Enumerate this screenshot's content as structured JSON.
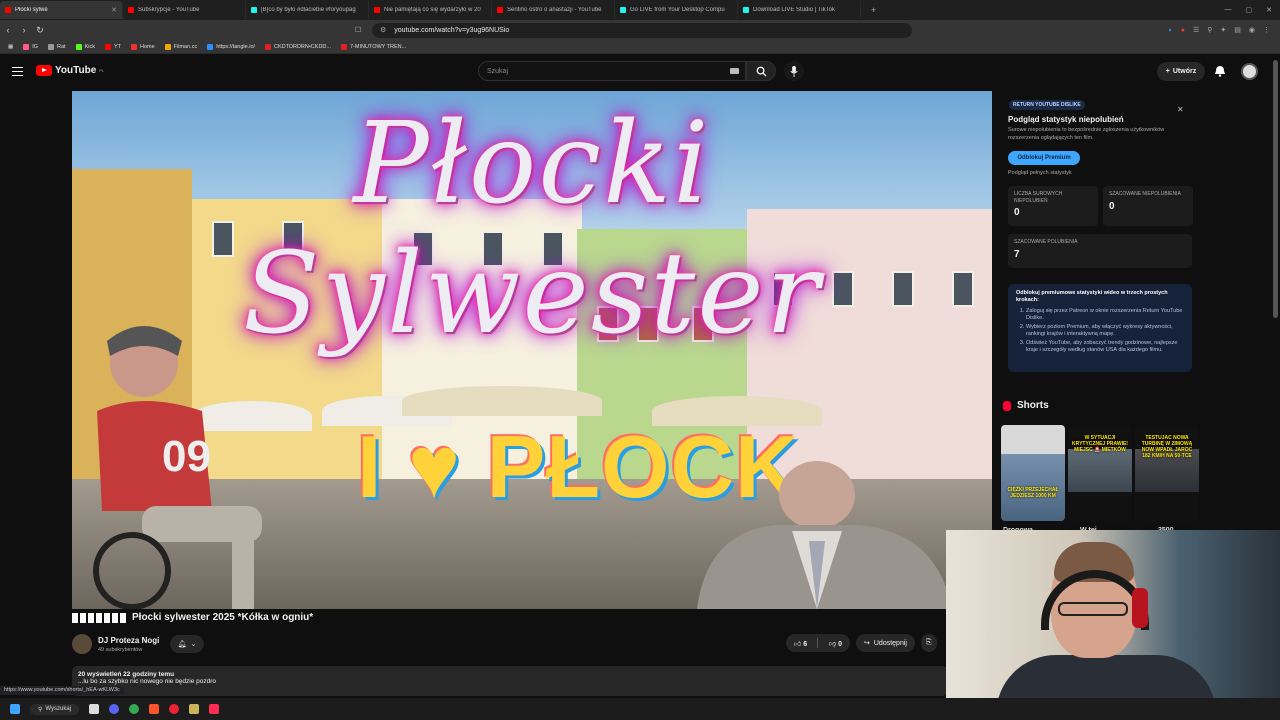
{
  "browser": {
    "tabs": [
      {
        "label": "Płocki sylwe",
        "color": "#ff0000",
        "active": true
      },
      {
        "label": "Subskrypcje - YouTube",
        "color": "#ff0000"
      },
      {
        "label": "[B]co by było #dlaciebie #foryoupag",
        "color": "#25f4ee"
      },
      {
        "label": "Nie pamiętają co się wydarzyło w 20",
        "color": "#ff0000"
      },
      {
        "label": "Sentino ostro o anastazji - YouTube",
        "color": "#ff0000"
      },
      {
        "label": "Go LIVE from Your Desktop Compu",
        "color": "#25f4ee"
      },
      {
        "label": "Download LIVE Studio | TikTok",
        "color": "#25f4ee"
      }
    ],
    "url": "youtube.com/watch?v=y3ug96NUSio",
    "bookmarks": [
      "IG",
      "Rat",
      "Kick",
      "YT",
      "Home",
      "Filman.cc",
      "https://tangle.io/",
      "CKDTDRDRN•CKDD...",
      "7-MINUTOWY TREN..."
    ]
  },
  "youtube": {
    "logo": "YouTube",
    "logo_region": "PL",
    "search_placeholder": "Szukaj",
    "create_label": "Utwórz"
  },
  "video": {
    "overlay_title": "Płocki Sylwester",
    "sign_text": "I ♥ PŁOCK",
    "title": "Płocki sylwester 2025 *Kółka w ogniu*",
    "channel": "DJ Proteza Nogi",
    "subscribers": "49 subskrybentów",
    "likes": "6",
    "dislikes": "0",
    "share_label": "Udostępnij",
    "views_time": "20 wyświetleń  22 godziny temu",
    "description": "...lu bo za szybko nic nowego nie będzie pozdro",
    "status_url": "https://www.youtube.com/shorts/_hEA-wKLW3c"
  },
  "rtd_panel": {
    "tag": "RETURN YOUTUBE DISLIKE",
    "title": "Podgląd statystyk niepolubień",
    "description": "Surowe niepolubienia to bezpośrednie zgłoszenia użytkowników rozszerzenia oglądających ten film.",
    "button": "Odblokuj Premium",
    "link": "Podgląd pełnych statystyk",
    "stats": [
      {
        "label": "LICZBA SUROWYCH NIEPOLUBIEŃ",
        "value": "0"
      },
      {
        "label": "SZACOWANE NIEPOLUBIENIA",
        "value": "0"
      },
      {
        "label": "SZACOWANE POLUBIENIA",
        "value": "7"
      }
    ],
    "premium_title": "Odblokuj premiumowe statystyki wideo w trzech prostych krokach:",
    "steps": [
      "Zaloguj się przez Patreon w oknie rozszerzenia Return YouTube Dislike.",
      "Wybierz poziom Premium, aby włączyć wykresy aktywności, rankingi krajów i interaktywną mapę.",
      "Odśwież YouTube, aby zobaczyć trendy godzinowe, najlepsze kraje i szczegóły według stanów USA dla każdego filmu."
    ]
  },
  "shorts": {
    "heading": "Shorts",
    "items": [
      {
        "caption": "CIĘŻKI PRZEJECHAŁ JEDZIESZ 1000 KM",
        "title": "Drogowa"
      },
      {
        "caption": "W SYTUACJI KRYTYCZNEJ PRAWIE! MIEJSC 🚨 MIETKÓW",
        "title": "W tej"
      },
      {
        "caption": "TESTUJAC NOWA TURBINĘ W ZIMOWĄ NOW WPADŁ JAROC 182 KM/H NA 50-TCE",
        "title": "3500"
      }
    ]
  },
  "taskbar": {
    "search_label": "Wyszukaj"
  }
}
